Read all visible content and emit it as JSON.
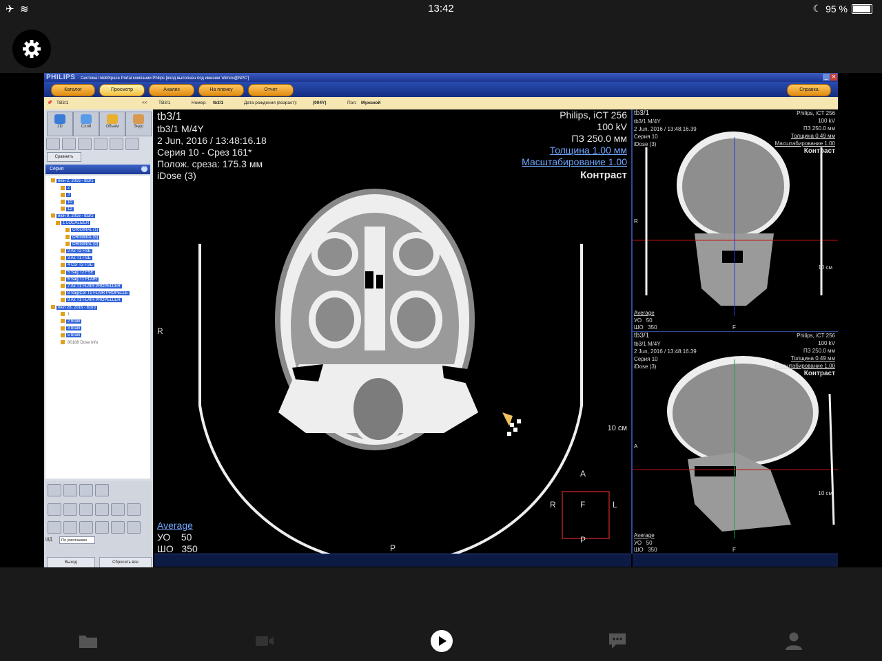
{
  "status": {
    "time": "13:42",
    "battery": "95 %",
    "battery_level": 0.95
  },
  "app": {
    "brand": "PHILIPS",
    "title": "Система IntelliSpace Portal компании Philips [вход выполнен под именем 'efimov@NPC']",
    "nav": [
      "Каталог",
      "Просмотр",
      "Анализ",
      "На пленку",
      "Отчет"
    ],
    "nav_active": "Просмотр",
    "help": "Справка"
  },
  "patient": {
    "tab": "TB3/1",
    "collapse": "<<",
    "name": "TB3/1",
    "number_label": "Номер:",
    "number": "tb3/1",
    "dob_label": "Дата рождения (возраст):",
    "dob": "(004Y)",
    "sex_label": "Пол:",
    "sex": "Мужской"
  },
  "leftpanel": {
    "modes": [
      "2D",
      "Слой",
      "Объем",
      "Эндо"
    ],
    "compare": "Сравнить",
    "series_title": "Серия",
    "tree": [
      {
        "indent": 0,
        "label": "июн 2, 2016 - tb3/1",
        "sel": true
      },
      {
        "indent": 2,
        "label": "2",
        "sel": true
      },
      {
        "indent": 2,
        "label": "3",
        "sel": true
      },
      {
        "indent": 2,
        "label": "10",
        "sel": true
      },
      {
        "indent": 2,
        "label": "12",
        "sel": true
      },
      {
        "indent": 0,
        "label": "июн 9, 2016 - tb3/2",
        "sel": true
      },
      {
        "indent": 1,
        "label": "1 LOCALIZER",
        "sel": true
      },
      {
        "indent": 3,
        "label": "ORIGINAL (1)",
        "sel": true
      },
      {
        "indent": 3,
        "label": "ORIGINAL (5)",
        "sel": true
      },
      {
        "indent": 3,
        "label": "ORIGINAL (9)",
        "sel": true
      },
      {
        "indent": 2,
        "label": "2 Ax T2 FSE",
        "sel": true
      },
      {
        "indent": 2,
        "label": "3 Ax T1 FSE",
        "sel": true
      },
      {
        "indent": 2,
        "label": "4 Cor T2 FSE",
        "sel": true
      },
      {
        "indent": 2,
        "label": "5 Sag T2 FSE",
        "sel": true
      },
      {
        "indent": 2,
        "label": "6 Sag T1 FLAIR",
        "sel": true
      },
      {
        "indent": 2,
        "label": "7 Ax T1 FLAIR PROPELLER",
        "sel": true
      },
      {
        "indent": 2,
        "label": "8 Sag/Cor T1 FLAIR PROPELLE",
        "sel": true
      },
      {
        "indent": 2,
        "label": "9 Ax T1 FLAIR PROPELLER",
        "sel": true
      },
      {
        "indent": 0,
        "label": "июл 28, 2016 - tb3/3",
        "sel": true
      },
      {
        "indent": 2,
        "label": "1",
        "sel": false
      },
      {
        "indent": 2,
        "label": "2 brain",
        "sel": true
      },
      {
        "indent": 2,
        "label": "3 brain",
        "sel": true
      },
      {
        "indent": 2,
        "label": "5 brain",
        "sel": true
      },
      {
        "indent": 2,
        "label": "80188 Dose Info",
        "sel": false
      }
    ],
    "shd_label": "ШД",
    "shd_value": "По умолчанию",
    "exit": "Выход",
    "reset": "Сбросить все"
  },
  "main": {
    "tl": [
      "tb3/1",
      "tb3/1 M/4Y",
      "2 Jun, 2016 / 13:48:16.18",
      "Серия 10 - Срез 161*",
      "Полож. среза: 175.3 мм",
      "iDose (3)"
    ],
    "tr_plain": [
      "Philips, iCT 256",
      "100 kV",
      "ПЗ 250.0 мм"
    ],
    "tr_links": [
      "Толщина 1.00 мм",
      "Масштабирование 1.00"
    ],
    "tr_bold": "Контраст",
    "bl_link": "Average",
    "bl": [
      "УО    50",
      "ШО   350"
    ],
    "scale": "10 см",
    "orient": {
      "left": "R",
      "bottom": "P",
      "cube_top": "A",
      "cube_left": "R",
      "cube_center": "F",
      "cube_right": "L",
      "cube_bottom": "P"
    }
  },
  "coronal": {
    "tl": [
      "tb3/1",
      "tb3/1 M/4Y",
      "2 Jun, 2016 / 13:48:16.39",
      "Серия 10",
      "iDose (3)"
    ],
    "tr_plain": [
      "Philips, iCT 256",
      "100 kV",
      "ПЗ 250.0 мм"
    ],
    "tr_links": [
      "Толщина 0.49 мм",
      "Масштабирование 1.00"
    ],
    "tr_bold": "Контраст",
    "bl_link": "Average",
    "bl": [
      "УО   50",
      "ШО   350"
    ],
    "scale": "10 см",
    "orient": {
      "left": "R",
      "bottom": "F"
    }
  },
  "sagittal": {
    "tl": [
      "tb3/1",
      "tb3/1 M/4Y",
      "2 Jun, 2016 / 13:48:16.39",
      "Серия 10",
      "iDose (3)"
    ],
    "tr_plain": [
      "Philips, iCT 256",
      "100 kV",
      "ПЗ 250.0 мм"
    ],
    "tr_links": [
      "Толщина 0.49 мм",
      "Масштабирование 1.00"
    ],
    "tr_bold": "Контраст",
    "bl_link": "Average",
    "bl": [
      "УО   50",
      "ШО   350"
    ],
    "scale": "10 см",
    "orient": {
      "left": "A",
      "bottom": "F"
    }
  },
  "tabs": [
    "folder-icon",
    "video-icon",
    "play-icon",
    "chat-icon",
    "profile-icon"
  ]
}
